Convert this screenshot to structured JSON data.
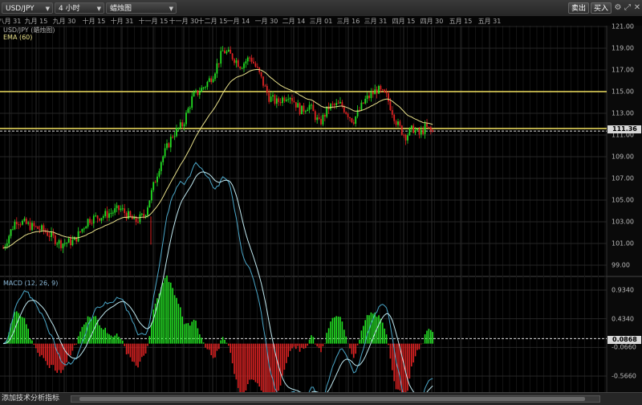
{
  "toolbar": {
    "symbol": "USD/JPY",
    "interval": "4 小时",
    "chart_style": "蜡烛图",
    "sell_label": "卖出",
    "buy_label": "买入",
    "icons": [
      "settings-icon",
      "restore-icon",
      "close-icon"
    ]
  },
  "x_axis_labels": [
    "八月 31",
    "九月 15",
    "九月 30",
    "十月 15",
    "十月 31",
    "十一月 15",
    "十一月 30",
    "十二月 15",
    "一月 14",
    "一月 30",
    "二月 14",
    "三月 01",
    "三月 16",
    "三月 31",
    "四月 15",
    "四月 30",
    "五月 15",
    "五月 31"
  ],
  "price_panel": {
    "title": "USD/JPY (蜡烛图)",
    "indicator": "EMA (60)",
    "y_labels": [
      "121.00",
      "119.00",
      "117.00",
      "115.00",
      "113.00",
      "111.00",
      "109.00",
      "107.00",
      "105.00",
      "103.00",
      "101.00",
      "99.00"
    ],
    "current_price": "111.36",
    "resistance_levels": [
      115.0,
      111.6
    ]
  },
  "macd_panel": {
    "title": "MACD (12, 26, 9)",
    "y_labels": [
      "0.9340",
      "0.4340",
      "-0.0660",
      "-0.5660"
    ],
    "current_value": "0.0868"
  },
  "bottom": {
    "add_indicator_label": "添加技术分析指标"
  },
  "colors": {
    "background": "#000000",
    "up": "#22dd22",
    "down": "#dd2222",
    "ema": "#e8e08a",
    "levels": "#f0e060",
    "macd_line": "#4aa6c8",
    "signal_line": "#bfe8f0"
  }
}
